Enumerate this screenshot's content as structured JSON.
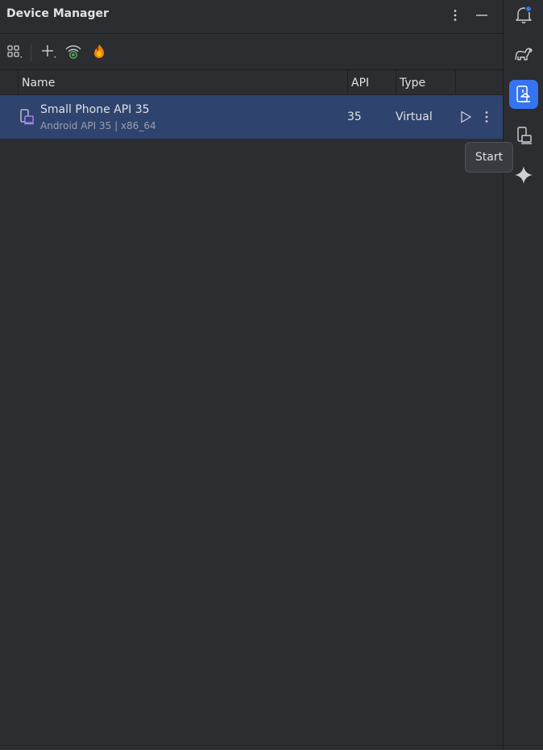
{
  "window": {
    "title": "Device Manager"
  },
  "titlebar_icons": [
    "more-vertical-icon",
    "minimize-icon"
  ],
  "toolbar": {
    "icons": [
      "group-by-icon",
      "add-device-icon",
      "pair-wifi-icon",
      "firebase-icon"
    ]
  },
  "table": {
    "columns": [
      "Name",
      "API",
      "Type"
    ],
    "rows": [
      {
        "name": "Small Phone API 35",
        "details": "Android API 35 | x86_64",
        "api": "35",
        "type": "Virtual",
        "selected": true
      }
    ]
  },
  "tooltip": {
    "text": "Start"
  },
  "right_toolbar": {
    "icons": [
      "notifications-icon",
      "gradle-icon",
      "device-manager-icon",
      "running-devices-icon",
      "gemini-icon"
    ],
    "active": "device-manager-icon"
  },
  "colors": {
    "background": "#2b2d30",
    "selection": "#2e436e",
    "accent": "#3574f0",
    "notification_dot": "#3574f0",
    "wifi_green": "#5fb865",
    "firebase_orange": "#f5820d"
  }
}
